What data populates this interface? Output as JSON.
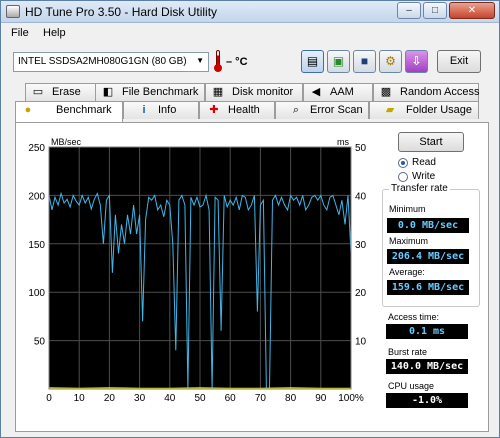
{
  "window": {
    "title": "HD Tune Pro 3.50 - Hard Disk Utility",
    "minimize": "–",
    "maximize": "□",
    "close": "✕"
  },
  "menu": {
    "file": "File",
    "help": "Help"
  },
  "toolbar": {
    "drive": "INTEL SSDSA2MH080G1GN (80 GB)",
    "temperature": "– °C",
    "exit": "Exit",
    "buttons": [
      "copy-info-icon",
      "copy-screenshot-icon",
      "save-icon",
      "options-icon",
      "download-icon"
    ]
  },
  "tabs_top": [
    {
      "label": "Erase",
      "icon": "erase-icon"
    },
    {
      "label": "File Benchmark",
      "icon": "file-benchmark-icon"
    },
    {
      "label": "Disk monitor",
      "icon": "disk-monitor-icon"
    },
    {
      "label": "AAM",
      "icon": "speaker-icon"
    },
    {
      "label": "Random Access",
      "icon": "random-access-icon"
    }
  ],
  "tabs_bottom": [
    {
      "label": "Benchmark",
      "icon": "benchmark-icon"
    },
    {
      "label": "Info",
      "icon": "info-icon"
    },
    {
      "label": "Health",
      "icon": "health-icon"
    },
    {
      "label": "Error Scan",
      "icon": "error-scan-icon"
    },
    {
      "label": "Folder Usage",
      "icon": "folder-icon"
    }
  ],
  "controls": {
    "start": "Start",
    "read": "Read",
    "write": "Write",
    "read_selected": true
  },
  "stats": {
    "transfer_rate_title": "Transfer rate",
    "minimum_label": "Minimum",
    "minimum_value": "0.0 MB/sec",
    "maximum_label": "Maximum",
    "maximum_value": "206.4 MB/sec",
    "average_label": "Average:",
    "average_value": "159.6 MB/sec",
    "access_label": "Access time:",
    "access_value": "0.1 ms",
    "burst_label": "Burst rate",
    "burst_value": "140.0 MB/sec",
    "cpu_label": "CPU usage",
    "cpu_value": "-1.0%"
  },
  "chart_data": {
    "type": "line",
    "left_unit": "MB/sec",
    "right_unit": "ms",
    "left_ticks": [
      "250",
      "200",
      "150",
      "100",
      "50"
    ],
    "right_ticks": [
      "50",
      "40",
      "30",
      "20",
      "10"
    ],
    "x_ticks": [
      "0",
      "10",
      "20",
      "30",
      "40",
      "50",
      "60",
      "70",
      "80",
      "90",
      "100%"
    ],
    "ylim_left": [
      0,
      250
    ],
    "ylim_right": [
      0,
      50
    ],
    "xlim": [
      0,
      100
    ],
    "grid": true,
    "colors": {
      "background": "#000000",
      "grid": "#4d4d4d",
      "transfer": "#3fb7e8",
      "access": "#e8e800",
      "axis_text": "#000000"
    },
    "series": [
      {
        "x": [
          0,
          1,
          2,
          3,
          4,
          5,
          6,
          7,
          8,
          9,
          10,
          11,
          12,
          13,
          14,
          15,
          16,
          17,
          18,
          19,
          20,
          21,
          22,
          23,
          24,
          25,
          26,
          27,
          28,
          29,
          30,
          31,
          32,
          33,
          34,
          35,
          36,
          37,
          38,
          39,
          40,
          41,
          42,
          43,
          44,
          45,
          46,
          47,
          48,
          49,
          50,
          51,
          52,
          53,
          54,
          55,
          56,
          57,
          58,
          59,
          60,
          61,
          62,
          63,
          64,
          65,
          66,
          67,
          68,
          69,
          70,
          71,
          72,
          73,
          74,
          75,
          76,
          77,
          78,
          79,
          80,
          81,
          82,
          83,
          84,
          85,
          86,
          87,
          88,
          89,
          90,
          91,
          92,
          93,
          94,
          95,
          96,
          97,
          98,
          99,
          100
        ],
        "y": [
          200,
          185,
          198,
          190,
          202,
          192,
          196,
          188,
          200,
          194,
          190,
          200,
          192,
          198,
          186,
          196,
          202,
          190,
          150,
          195,
          200,
          120,
          180,
          140,
          170,
          150,
          180,
          160,
          190,
          160,
          180,
          70,
          175,
          198,
          195,
          200,
          185,
          190,
          178,
          195,
          190,
          150,
          40,
          195,
          200,
          190,
          0,
          198,
          190,
          198,
          188,
          190,
          200,
          185,
          0,
          198,
          195,
          60,
          200,
          188,
          195,
          190,
          198,
          185,
          200,
          198,
          185,
          190,
          200,
          80,
          190,
          195,
          0,
          0,
          195,
          200,
          190,
          198,
          190,
          185,
          200,
          195,
          198,
          190,
          200,
          185,
          190,
          198,
          200,
          195,
          200,
          190,
          185,
          198,
          200,
          190,
          180,
          195,
          170,
          200,
          140
        ]
      },
      {
        "x": [
          0,
          10,
          20,
          30,
          40,
          50,
          60,
          70,
          80,
          90,
          100
        ],
        "y": [
          0.2,
          0.1,
          0.2,
          0.1,
          0.1,
          0.2,
          0.1,
          0.1,
          0.2,
          0.1,
          0.1
        ]
      }
    ]
  }
}
